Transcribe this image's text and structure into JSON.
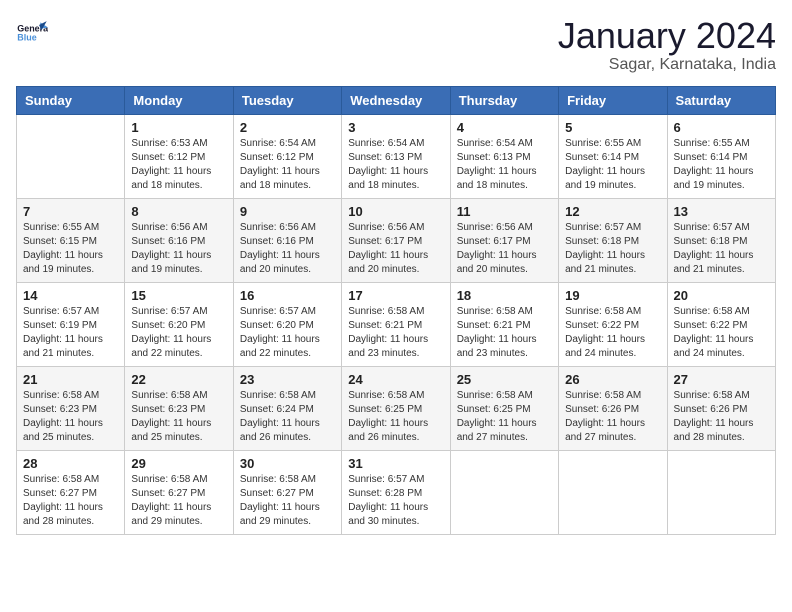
{
  "header": {
    "logo_general": "General",
    "logo_blue": "Blue",
    "month": "January 2024",
    "location": "Sagar, Karnataka, India"
  },
  "weekdays": [
    "Sunday",
    "Monday",
    "Tuesday",
    "Wednesday",
    "Thursday",
    "Friday",
    "Saturday"
  ],
  "weeks": [
    [
      {
        "day": "",
        "sunrise": "",
        "sunset": "",
        "daylight": ""
      },
      {
        "day": "1",
        "sunrise": "Sunrise: 6:53 AM",
        "sunset": "Sunset: 6:12 PM",
        "daylight": "Daylight: 11 hours and 18 minutes."
      },
      {
        "day": "2",
        "sunrise": "Sunrise: 6:54 AM",
        "sunset": "Sunset: 6:12 PM",
        "daylight": "Daylight: 11 hours and 18 minutes."
      },
      {
        "day": "3",
        "sunrise": "Sunrise: 6:54 AM",
        "sunset": "Sunset: 6:13 PM",
        "daylight": "Daylight: 11 hours and 18 minutes."
      },
      {
        "day": "4",
        "sunrise": "Sunrise: 6:54 AM",
        "sunset": "Sunset: 6:13 PM",
        "daylight": "Daylight: 11 hours and 18 minutes."
      },
      {
        "day": "5",
        "sunrise": "Sunrise: 6:55 AM",
        "sunset": "Sunset: 6:14 PM",
        "daylight": "Daylight: 11 hours and 19 minutes."
      },
      {
        "day": "6",
        "sunrise": "Sunrise: 6:55 AM",
        "sunset": "Sunset: 6:14 PM",
        "daylight": "Daylight: 11 hours and 19 minutes."
      }
    ],
    [
      {
        "day": "7",
        "sunrise": "Sunrise: 6:55 AM",
        "sunset": "Sunset: 6:15 PM",
        "daylight": "Daylight: 11 hours and 19 minutes."
      },
      {
        "day": "8",
        "sunrise": "Sunrise: 6:56 AM",
        "sunset": "Sunset: 6:16 PM",
        "daylight": "Daylight: 11 hours and 19 minutes."
      },
      {
        "day": "9",
        "sunrise": "Sunrise: 6:56 AM",
        "sunset": "Sunset: 6:16 PM",
        "daylight": "Daylight: 11 hours and 20 minutes."
      },
      {
        "day": "10",
        "sunrise": "Sunrise: 6:56 AM",
        "sunset": "Sunset: 6:17 PM",
        "daylight": "Daylight: 11 hours and 20 minutes."
      },
      {
        "day": "11",
        "sunrise": "Sunrise: 6:56 AM",
        "sunset": "Sunset: 6:17 PM",
        "daylight": "Daylight: 11 hours and 20 minutes."
      },
      {
        "day": "12",
        "sunrise": "Sunrise: 6:57 AM",
        "sunset": "Sunset: 6:18 PM",
        "daylight": "Daylight: 11 hours and 21 minutes."
      },
      {
        "day": "13",
        "sunrise": "Sunrise: 6:57 AM",
        "sunset": "Sunset: 6:18 PM",
        "daylight": "Daylight: 11 hours and 21 minutes."
      }
    ],
    [
      {
        "day": "14",
        "sunrise": "Sunrise: 6:57 AM",
        "sunset": "Sunset: 6:19 PM",
        "daylight": "Daylight: 11 hours and 21 minutes."
      },
      {
        "day": "15",
        "sunrise": "Sunrise: 6:57 AM",
        "sunset": "Sunset: 6:20 PM",
        "daylight": "Daylight: 11 hours and 22 minutes."
      },
      {
        "day": "16",
        "sunrise": "Sunrise: 6:57 AM",
        "sunset": "Sunset: 6:20 PM",
        "daylight": "Daylight: 11 hours and 22 minutes."
      },
      {
        "day": "17",
        "sunrise": "Sunrise: 6:58 AM",
        "sunset": "Sunset: 6:21 PM",
        "daylight": "Daylight: 11 hours and 23 minutes."
      },
      {
        "day": "18",
        "sunrise": "Sunrise: 6:58 AM",
        "sunset": "Sunset: 6:21 PM",
        "daylight": "Daylight: 11 hours and 23 minutes."
      },
      {
        "day": "19",
        "sunrise": "Sunrise: 6:58 AM",
        "sunset": "Sunset: 6:22 PM",
        "daylight": "Daylight: 11 hours and 24 minutes."
      },
      {
        "day": "20",
        "sunrise": "Sunrise: 6:58 AM",
        "sunset": "Sunset: 6:22 PM",
        "daylight": "Daylight: 11 hours and 24 minutes."
      }
    ],
    [
      {
        "day": "21",
        "sunrise": "Sunrise: 6:58 AM",
        "sunset": "Sunset: 6:23 PM",
        "daylight": "Daylight: 11 hours and 25 minutes."
      },
      {
        "day": "22",
        "sunrise": "Sunrise: 6:58 AM",
        "sunset": "Sunset: 6:23 PM",
        "daylight": "Daylight: 11 hours and 25 minutes."
      },
      {
        "day": "23",
        "sunrise": "Sunrise: 6:58 AM",
        "sunset": "Sunset: 6:24 PM",
        "daylight": "Daylight: 11 hours and 26 minutes."
      },
      {
        "day": "24",
        "sunrise": "Sunrise: 6:58 AM",
        "sunset": "Sunset: 6:25 PM",
        "daylight": "Daylight: 11 hours and 26 minutes."
      },
      {
        "day": "25",
        "sunrise": "Sunrise: 6:58 AM",
        "sunset": "Sunset: 6:25 PM",
        "daylight": "Daylight: 11 hours and 27 minutes."
      },
      {
        "day": "26",
        "sunrise": "Sunrise: 6:58 AM",
        "sunset": "Sunset: 6:26 PM",
        "daylight": "Daylight: 11 hours and 27 minutes."
      },
      {
        "day": "27",
        "sunrise": "Sunrise: 6:58 AM",
        "sunset": "Sunset: 6:26 PM",
        "daylight": "Daylight: 11 hours and 28 minutes."
      }
    ],
    [
      {
        "day": "28",
        "sunrise": "Sunrise: 6:58 AM",
        "sunset": "Sunset: 6:27 PM",
        "daylight": "Daylight: 11 hours and 28 minutes."
      },
      {
        "day": "29",
        "sunrise": "Sunrise: 6:58 AM",
        "sunset": "Sunset: 6:27 PM",
        "daylight": "Daylight: 11 hours and 29 minutes."
      },
      {
        "day": "30",
        "sunrise": "Sunrise: 6:58 AM",
        "sunset": "Sunset: 6:27 PM",
        "daylight": "Daylight: 11 hours and 29 minutes."
      },
      {
        "day": "31",
        "sunrise": "Sunrise: 6:57 AM",
        "sunset": "Sunset: 6:28 PM",
        "daylight": "Daylight: 11 hours and 30 minutes."
      },
      {
        "day": "",
        "sunrise": "",
        "sunset": "",
        "daylight": ""
      },
      {
        "day": "",
        "sunrise": "",
        "sunset": "",
        "daylight": ""
      },
      {
        "day": "",
        "sunrise": "",
        "sunset": "",
        "daylight": ""
      }
    ]
  ]
}
